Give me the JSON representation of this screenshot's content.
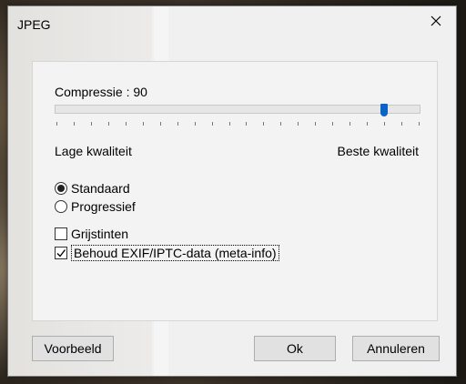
{
  "window": {
    "title": "JPEG"
  },
  "compression": {
    "label": "Compressie : 90",
    "value": 90,
    "min": 0,
    "max": 100,
    "low_label": "Lage kwaliteit",
    "high_label": "Beste kwaliteit",
    "accent_color": "#0a64c8"
  },
  "encoding": {
    "options": [
      {
        "label": "Standaard",
        "selected": true
      },
      {
        "label": "Progressief",
        "selected": false
      }
    ]
  },
  "options": {
    "grayscale_label": "Grijstinten",
    "grayscale_checked": false,
    "keep_exif_label": "Behoud EXIF/IPTC-data (meta-info)",
    "keep_exif_checked": true
  },
  "buttons": {
    "preview": "Voorbeeld",
    "ok": "Ok",
    "cancel": "Annuleren"
  },
  "icons": {
    "close": "close-icon",
    "check": "checkmark-icon"
  }
}
